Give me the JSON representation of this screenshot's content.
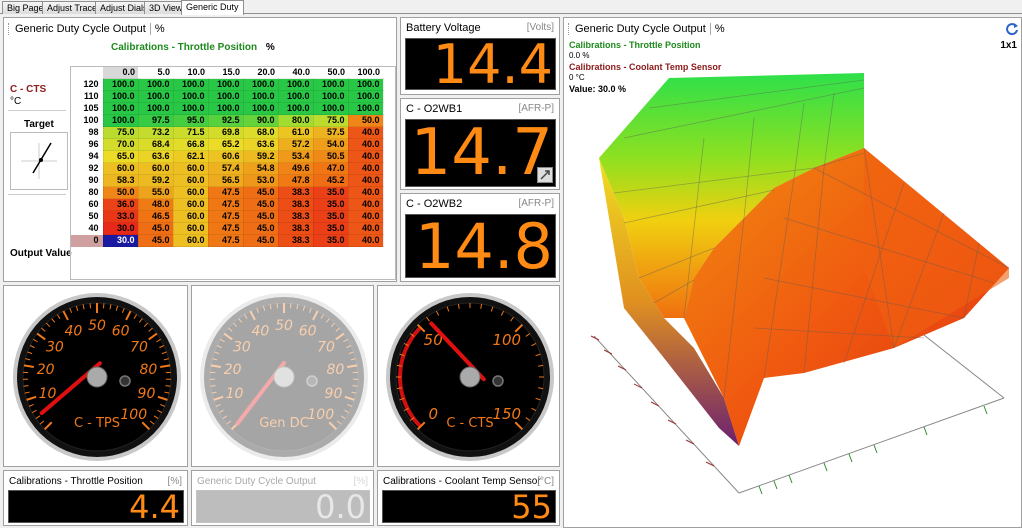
{
  "tabs": [
    "Big Page",
    "Adjust Trace",
    "Adjust Dials",
    "3D View",
    "Generic Duty"
  ],
  "active_tab": "Generic Duty",
  "table_panel": {
    "title": "Generic Duty Cycle Output",
    "unit": "%",
    "col_axis_label": "Calibrations - Throttle Position",
    "col_axis_unit": "%",
    "row_axis_label": "C - CTS",
    "row_axis_unit": "°C",
    "target_label": "Target",
    "output_label": "Output Value",
    "columns": [
      "0.0",
      "5.0",
      "10.0",
      "15.0",
      "20.0",
      "40.0",
      "50.0",
      "100.0"
    ],
    "rows": [
      {
        "h": "120",
        "v": [
          "100.0",
          "100.0",
          "100.0",
          "100.0",
          "100.0",
          "100.0",
          "100.0",
          "100.0"
        ]
      },
      {
        "h": "110",
        "v": [
          "100.0",
          "100.0",
          "100.0",
          "100.0",
          "100.0",
          "100.0",
          "100.0",
          "100.0"
        ]
      },
      {
        "h": "105",
        "v": [
          "100.0",
          "100.0",
          "100.0",
          "100.0",
          "100.0",
          "100.0",
          "100.0",
          "100.0"
        ]
      },
      {
        "h": "100",
        "v": [
          "100.0",
          "97.5",
          "95.0",
          "92.5",
          "90.0",
          "80.0",
          "75.0",
          "50.0"
        ]
      },
      {
        "h": "98",
        "v": [
          "75.0",
          "73.2",
          "71.5",
          "69.8",
          "68.0",
          "61.0",
          "57.5",
          "40.0"
        ]
      },
      {
        "h": "96",
        "v": [
          "70.0",
          "68.4",
          "66.8",
          "65.2",
          "63.6",
          "57.2",
          "54.0",
          "40.0"
        ]
      },
      {
        "h": "94",
        "v": [
          "65.0",
          "63.6",
          "62.1",
          "60.6",
          "59.2",
          "53.4",
          "50.5",
          "40.0"
        ]
      },
      {
        "h": "92",
        "v": [
          "60.0",
          "60.0",
          "60.0",
          "57.4",
          "54.8",
          "49.6",
          "47.0",
          "40.0"
        ]
      },
      {
        "h": "90",
        "v": [
          "58.3",
          "59.2",
          "60.0",
          "56.5",
          "53.0",
          "47.8",
          "45.2",
          "40.0"
        ]
      },
      {
        "h": "80",
        "v": [
          "50.0",
          "55.0",
          "60.0",
          "47.5",
          "45.0",
          "38.3",
          "35.0",
          "40.0"
        ]
      },
      {
        "h": "60",
        "v": [
          "36.0",
          "48.0",
          "60.0",
          "47.5",
          "45.0",
          "38.3",
          "35.0",
          "40.0"
        ]
      },
      {
        "h": "50",
        "v": [
          "33.0",
          "46.5",
          "60.0",
          "47.5",
          "45.0",
          "38.3",
          "35.0",
          "40.0"
        ]
      },
      {
        "h": "40",
        "v": [
          "30.0",
          "45.0",
          "60.0",
          "47.5",
          "45.0",
          "38.3",
          "35.0",
          "40.0"
        ]
      },
      {
        "h": "0",
        "v": [
          "30.0",
          "45.0",
          "60.0",
          "47.5",
          "45.0",
          "38.3",
          "35.0",
          "40.0"
        ]
      }
    ],
    "selected_row": 13,
    "selected_col": 0
  },
  "readouts": [
    {
      "label": "Battery Voltage",
      "unit": "[Volts]",
      "value": "14.4"
    },
    {
      "label": "C - O2WB1",
      "unit": "[AFR-P]",
      "value": "14.7"
    },
    {
      "label": "C - O2WB2",
      "unit": "[AFR-P]",
      "value": "14.8"
    }
  ],
  "gauges": [
    {
      "name": "C - TPS",
      "ticks": [
        "0",
        "10",
        "20",
        "30",
        "40",
        "50",
        "60",
        "70",
        "80",
        "90",
        "100"
      ],
      "value_fraction": 0.044
    },
    {
      "name": "Gen DC",
      "ticks": [
        "0",
        "10",
        "20",
        "30",
        "40",
        "50",
        "60",
        "70",
        "80",
        "90",
        "100"
      ],
      "value_fraction": 0.0
    },
    {
      "name": "C - CTS",
      "ticks": [
        "0",
        "50",
        "100",
        "150"
      ],
      "value_fraction": 0.367
    }
  ],
  "bottom_readouts": [
    {
      "label": "Calibrations - Throttle Position",
      "unit": "[%]",
      "value": "4.4"
    },
    {
      "label": "Generic Duty Cycle Output",
      "unit": "[%]",
      "value": "0.0"
    },
    {
      "label": "Calibrations - Coolant Temp Sensor",
      "unit": "[°C]",
      "value": "55"
    }
  ],
  "view3d": {
    "title": "Generic Duty Cycle Output",
    "unit": "%",
    "zoom": "1x1",
    "x_label": "Calibrations - Throttle Position",
    "x_value": "0.0 %",
    "y_label": "Calibrations - Coolant Temp Sensor",
    "y_value": "0 °C",
    "value_text": "Value: 30.0 %",
    "colors": {
      "x_label": "#1e8a1e",
      "y_label": "#8b1a1a",
      "refresh": "#2a64c8"
    }
  }
}
